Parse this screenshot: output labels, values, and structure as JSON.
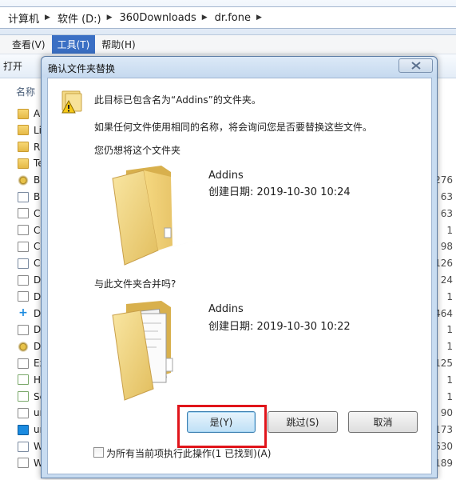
{
  "address_bar": {
    "crumbs": [
      "计算机",
      "软件 (D:)",
      "360Downloads",
      "dr.fone"
    ]
  },
  "menu": {
    "items": [
      {
        "label": "查看(V)",
        "active": false
      },
      {
        "label": "工具(T)",
        "active": true
      },
      {
        "label": "帮助(H)",
        "active": false
      }
    ]
  },
  "toolbar": {
    "open_label": "打开"
  },
  "file_list": {
    "column_name": "名称",
    "rows": [
      {
        "name": "A",
        "icon": "folder-icon",
        "size": ""
      },
      {
        "name": "Li",
        "icon": "folder-icon",
        "size": ""
      },
      {
        "name": "R",
        "icon": "folder-icon",
        "size": ""
      },
      {
        "name": "Te",
        "icon": "folder-icon",
        "size": ""
      },
      {
        "name": "B",
        "icon": "gear-icon",
        "size": "276"
      },
      {
        "name": "B",
        "icon": "app-icon",
        "size": "63"
      },
      {
        "name": "C",
        "icon": "dll-icon",
        "size": "63"
      },
      {
        "name": "C",
        "icon": "dll-icon",
        "size": "1"
      },
      {
        "name": "C",
        "icon": "dll-icon",
        "size": "98"
      },
      {
        "name": "C",
        "icon": "app-icon",
        "size": "126"
      },
      {
        "name": "D",
        "icon": "dll-icon",
        "size": "24"
      },
      {
        "name": "D",
        "icon": "dll-icon",
        "size": "1"
      },
      {
        "name": "D",
        "icon": "plus-icon",
        "size": "464"
      },
      {
        "name": "D",
        "icon": "dll-icon",
        "size": "1"
      },
      {
        "name": "D",
        "icon": "gear-icon",
        "size": "1"
      },
      {
        "name": "Ex",
        "icon": "dll-icon",
        "size": "125"
      },
      {
        "name": "H",
        "icon": "green-icon",
        "size": "1"
      },
      {
        "name": "Se",
        "icon": "green-icon",
        "size": "1"
      },
      {
        "name": "ur",
        "icon": "dll-icon",
        "size": "90"
      },
      {
        "name": "ur",
        "icon": "blue-plus-icon",
        "size": "173"
      },
      {
        "name": "W",
        "icon": "app-icon",
        "size": "630"
      },
      {
        "name": "W",
        "icon": "dll-icon",
        "size": "189"
      }
    ]
  },
  "dialog": {
    "title": "确认文件夹替换",
    "message_line1": "此目标已包含名为“Addins”的文件夹。",
    "message_line2": "如果任何文件使用相同的名称，将会询问您是否要替换这些文件。",
    "still_merge_prompt": "您仍想将这个文件夹",
    "existing": {
      "name": "Addins",
      "created": "创建日期: 2019-10-30 10:24"
    },
    "merge_with_prompt": "与此文件夹合并吗?",
    "incoming": {
      "name": "Addins",
      "created": "创建日期: 2019-10-30 10:22"
    },
    "yes_label": "是(Y)",
    "skip_label": "跳过(S)",
    "cancel_label": "取消",
    "apply_all_label": "为所有当前项执行此操作(1 已找到)(A)",
    "apply_all_checked": false
  },
  "colors": {
    "accent_menu": "#3a6fc4",
    "highlight_box": "#e0151b",
    "dialog_frame": "#c8dcf1"
  }
}
